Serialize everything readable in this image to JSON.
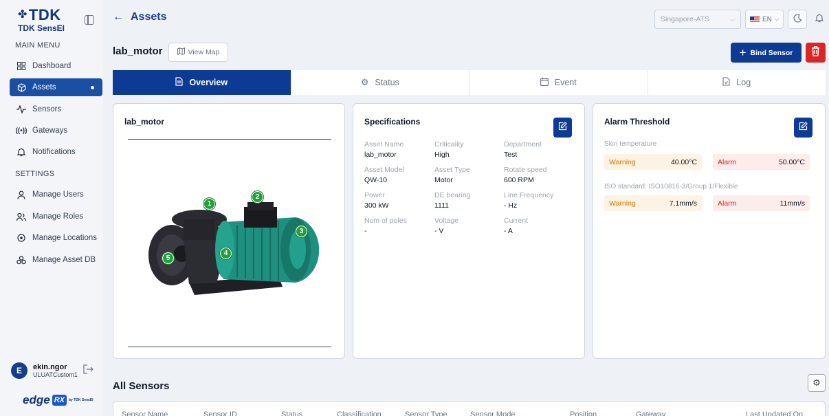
{
  "brand": {
    "logo_text": "TDK",
    "product": "TDK SensEI"
  },
  "sidebar": {
    "main_menu_label": "MAIN MENU",
    "settings_label": "SETTINGS",
    "main_items": [
      {
        "label": "Dashboard",
        "icon": "grid-icon"
      },
      {
        "label": "Assets",
        "icon": "cube-icon",
        "active": true
      },
      {
        "label": "Sensors",
        "icon": "pulse-icon"
      },
      {
        "label": "Gateways",
        "icon": "broadcast-icon"
      },
      {
        "label": "Notifications",
        "icon": "bell-icon"
      }
    ],
    "settings_items": [
      {
        "label": "Manage Users",
        "icon": "user-icon"
      },
      {
        "label": "Manage Roles",
        "icon": "users-icon"
      },
      {
        "label": "Manage Locations",
        "icon": "location-pin-icon"
      },
      {
        "label": "Manage Asset DB",
        "icon": "database-icon"
      }
    ],
    "user": {
      "initial": "E",
      "name": "ekin.ngor",
      "tenant": "ULUATCustom1"
    },
    "footer_logo": {
      "edge": "edge",
      "rx": "RX",
      "by": "by TDK SensEI"
    }
  },
  "header": {
    "title": "Assets",
    "site_placeholder": "Singapore-ATS",
    "lang": "EN"
  },
  "asset": {
    "name": "lab_motor",
    "view_map_label": "View Map",
    "bind_label": "Bind Sensor"
  },
  "tabs": [
    {
      "label": "Overview",
      "icon": "document-icon",
      "active": true
    },
    {
      "label": "Status",
      "icon": "gear-icon"
    },
    {
      "label": "Event",
      "icon": "calendar-icon"
    },
    {
      "label": "Log",
      "icon": "file-icon"
    }
  ],
  "image_card": {
    "title": "lab_motor",
    "markers": [
      "1",
      "2",
      "3",
      "4",
      "5"
    ]
  },
  "specifications": {
    "title": "Specifications",
    "fields": [
      {
        "key": "Asset Name",
        "value": "lab_motor"
      },
      {
        "key": "Criticality",
        "value": "High"
      },
      {
        "key": "Department",
        "value": "Test"
      },
      {
        "key": "Asset Model",
        "value": "QW-10"
      },
      {
        "key": "Asset Type",
        "value": "Motor"
      },
      {
        "key": "Rotate speed",
        "value": "600 RPM"
      },
      {
        "key": "Power",
        "value": "300 kW"
      },
      {
        "key": "DE bearing",
        "value": "1111"
      },
      {
        "key": "Line Frequency",
        "value": "- Hz"
      },
      {
        "key": "Num of poles",
        "value": "-"
      },
      {
        "key": "Voltage",
        "value": "- V"
      },
      {
        "key": "Current",
        "value": "- A"
      }
    ]
  },
  "alarm_threshold": {
    "title": "Alarm Threshold",
    "groups": [
      {
        "label": "Skin temperature",
        "warning_label": "Warning",
        "warning_value": "40.00°C",
        "alarm_label": "Alarm",
        "alarm_value": "50.00°C"
      },
      {
        "label": "ISO standard: ISO10816-3/Group 1/Flexible",
        "warning_label": "Warning",
        "warning_value": "7.1mm/s",
        "alarm_label": "Alarm",
        "alarm_value": "11mm/s"
      }
    ]
  },
  "sensors": {
    "title": "All Sensors",
    "columns": [
      "Sensor Name",
      "Sensor ID",
      "Status",
      "Classification",
      "Sensor Type",
      "Sensor Mode",
      "Position",
      "Gateway",
      "Last Updated On"
    ]
  },
  "colors": {
    "primary": "#0d3b94",
    "danger": "#dc2626",
    "marker": "#22a03b",
    "warning_bg": "#fdf3e4",
    "alarm_bg": "#fdecec"
  }
}
